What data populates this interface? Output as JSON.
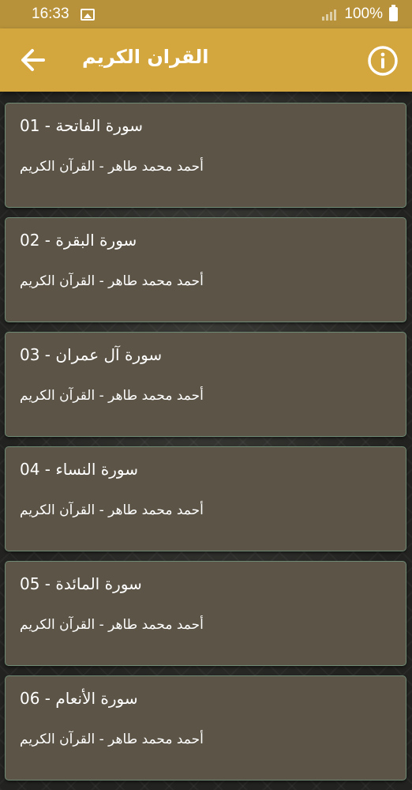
{
  "status_bar": {
    "time": "16:33",
    "battery": "100%"
  },
  "app_bar": {
    "title": "القران الكريم",
    "back_icon": "arrow-left-icon",
    "info_icon": "info-icon"
  },
  "colors": {
    "status_bar": "#b7923a",
    "app_bar": "#d3a63e",
    "card": "#5c5446",
    "card_border": "#6e8a74"
  },
  "surahs": [
    {
      "title": "سورة الفاتحة - 01",
      "subtitle": "أحمد محمد طاهر - القرآن الكريم"
    },
    {
      "title": "سورة البقرة - 02",
      "subtitle": "أحمد محمد طاهر - القرآن الكريم"
    },
    {
      "title": "سورة آل عمران - 03",
      "subtitle": "أحمد محمد طاهر - القرآن الكريم"
    },
    {
      "title": "سورة النساء - 04",
      "subtitle": "أحمد محمد طاهر - القرآن الكريم"
    },
    {
      "title": "سورة المائدة - 05",
      "subtitle": "أحمد محمد طاهر - القرآن الكريم"
    },
    {
      "title": "سورة الأنعام - 06",
      "subtitle": "أحمد محمد طاهر - القرآن الكريم"
    }
  ]
}
